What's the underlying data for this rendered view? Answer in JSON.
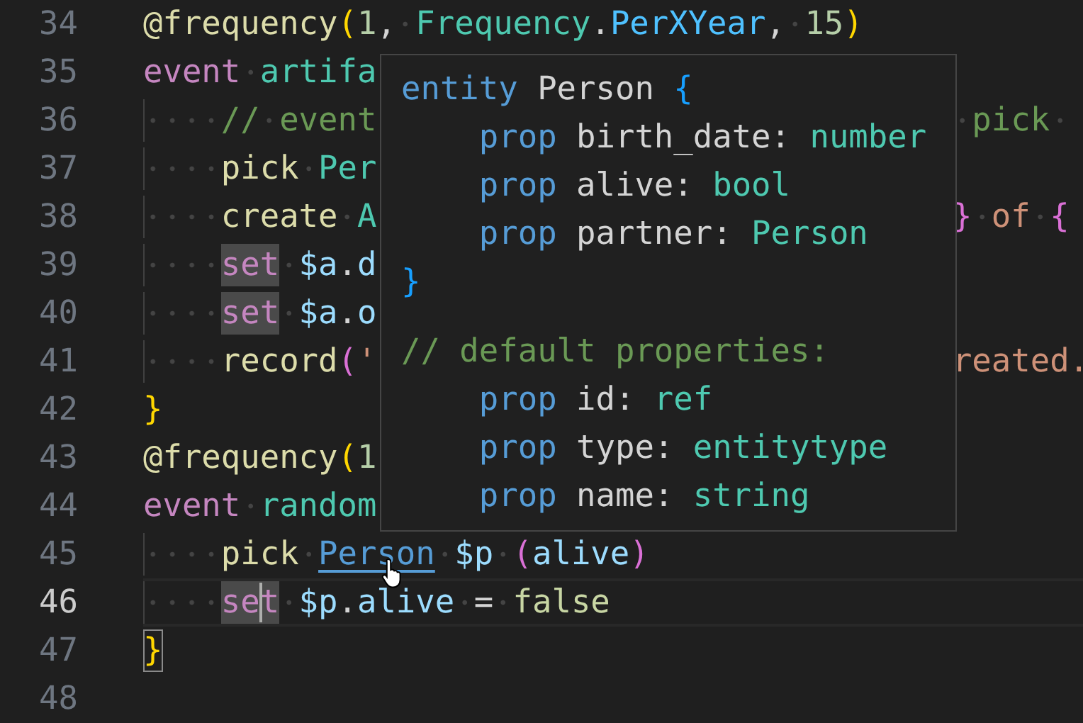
{
  "editor": {
    "lines": [
      {
        "number": "34",
        "current": false,
        "left": [
          {
            "kind": "fn",
            "t": "@frequency"
          },
          {
            "kind": "b1",
            "t": "("
          },
          {
            "kind": "num",
            "t": "1"
          },
          {
            "kind": "plain",
            "t": ","
          },
          {
            "kind": "ws"
          },
          {
            "kind": "type",
            "t": "Frequency"
          },
          {
            "kind": "plain",
            "t": "."
          },
          {
            "kind": "const",
            "t": "PerXYear"
          },
          {
            "kind": "plain",
            "t": ","
          },
          {
            "kind": "ws"
          },
          {
            "kind": "num",
            "t": "15"
          },
          {
            "kind": "b1",
            "t": ")"
          }
        ]
      },
      {
        "number": "35",
        "current": false,
        "left": [
          {
            "kind": "kw",
            "t": "event"
          },
          {
            "kind": "ws"
          },
          {
            "kind": "type",
            "t": "artifa"
          }
        ]
      },
      {
        "number": "36",
        "current": false,
        "left": [
          {
            "kind": "ws-indent"
          },
          {
            "kind": "comment",
            "t": "//"
          },
          {
            "kind": "ws"
          },
          {
            "kind": "comment",
            "t": "event"
          }
        ],
        "right": [
          {
            "kind": "ws"
          },
          {
            "kind": "comment",
            "t": "pick"
          },
          {
            "kind": "ws"
          }
        ]
      },
      {
        "number": "37",
        "current": false,
        "left": [
          {
            "kind": "ws-indent"
          },
          {
            "kind": "fn",
            "t": "pick"
          },
          {
            "kind": "ws"
          },
          {
            "kind": "type",
            "t": "Per"
          }
        ]
      },
      {
        "number": "38",
        "current": false,
        "left": [
          {
            "kind": "ws-indent"
          },
          {
            "kind": "fn",
            "t": "create"
          },
          {
            "kind": "ws"
          },
          {
            "kind": "type",
            "t": "A"
          }
        ],
        "right": [
          {
            "kind": "b2",
            "t": "}"
          },
          {
            "kind": "ws"
          },
          {
            "kind": "str",
            "t": "of"
          },
          {
            "kind": "ws"
          },
          {
            "kind": "b2",
            "t": "{"
          }
        ]
      },
      {
        "number": "39",
        "current": false,
        "left": [
          {
            "kind": "ws-indent"
          },
          {
            "kind": "kw-hl",
            "t": "set"
          },
          {
            "kind": "ws"
          },
          {
            "kind": "var",
            "t": "$a"
          },
          {
            "kind": "plain",
            "t": "."
          },
          {
            "kind": "var",
            "t": "d"
          }
        ]
      },
      {
        "number": "40",
        "current": false,
        "left": [
          {
            "kind": "ws-indent"
          },
          {
            "kind": "kw-hl",
            "t": "set"
          },
          {
            "kind": "ws"
          },
          {
            "kind": "var",
            "t": "$a"
          },
          {
            "kind": "plain",
            "t": "."
          },
          {
            "kind": "var",
            "t": "o"
          }
        ]
      },
      {
        "number": "41",
        "current": false,
        "left": [
          {
            "kind": "ws-indent"
          },
          {
            "kind": "fn",
            "t": "record"
          },
          {
            "kind": "b2",
            "t": "("
          },
          {
            "kind": "str",
            "t": "'"
          }
        ],
        "right": [
          {
            "kind": "str",
            "t": "reated."
          }
        ]
      },
      {
        "number": "42",
        "current": false,
        "left": [
          {
            "kind": "b1",
            "t": "}"
          }
        ]
      },
      {
        "number": "43",
        "current": false,
        "left": [
          {
            "kind": "fn",
            "t": "@frequency"
          },
          {
            "kind": "b1",
            "t": "("
          },
          {
            "kind": "num",
            "t": "1"
          }
        ]
      },
      {
        "number": "44",
        "current": false,
        "left": [
          {
            "kind": "kw",
            "t": "event"
          },
          {
            "kind": "ws"
          },
          {
            "kind": "type",
            "t": "random"
          }
        ]
      },
      {
        "number": "45",
        "current": false,
        "left": [
          {
            "kind": "ws-indent"
          },
          {
            "kind": "fn",
            "t": "pick"
          },
          {
            "kind": "ws"
          },
          {
            "kind": "link",
            "t": "Person"
          },
          {
            "kind": "pointer"
          },
          {
            "kind": "ws"
          },
          {
            "kind": "var",
            "t": "$p"
          },
          {
            "kind": "ws"
          },
          {
            "kind": "b2",
            "t": "("
          },
          {
            "kind": "var",
            "t": "alive"
          },
          {
            "kind": "b2",
            "t": ")"
          }
        ]
      },
      {
        "number": "46",
        "current": true,
        "left": [
          {
            "kind": "ws-indent"
          },
          {
            "kind": "kw-hl",
            "t": "se"
          },
          {
            "kind": "caret"
          },
          {
            "kind": "kw-hl",
            "t": "t"
          },
          {
            "kind": "ws"
          },
          {
            "kind": "var",
            "t": "$p"
          },
          {
            "kind": "plain",
            "t": "."
          },
          {
            "kind": "var",
            "t": "alive"
          },
          {
            "kind": "ws"
          },
          {
            "kind": "plain",
            "t": "="
          },
          {
            "kind": "ws"
          },
          {
            "kind": "lit",
            "t": "false"
          }
        ]
      },
      {
        "number": "47",
        "current": false,
        "left": [
          {
            "kind": "brace-match",
            "t": "}"
          }
        ]
      },
      {
        "number": "48",
        "current": false
      }
    ],
    "hover": {
      "sections": [
        {
          "lines": [
            [
              {
                "kind": "decl",
                "t": "entity"
              },
              {
                "kind": "sp"
              },
              {
                "kind": "plain",
                "t": "Person"
              },
              {
                "kind": "sp"
              },
              {
                "kind": "b3",
                "t": "{"
              }
            ],
            [
              {
                "kind": "sp-indent"
              },
              {
                "kind": "decl",
                "t": "prop"
              },
              {
                "kind": "sp"
              },
              {
                "kind": "plain",
                "t": "birth_date:"
              },
              {
                "kind": "sp"
              },
              {
                "kind": "type",
                "t": "number"
              }
            ],
            [
              {
                "kind": "sp-indent"
              },
              {
                "kind": "decl",
                "t": "prop"
              },
              {
                "kind": "sp"
              },
              {
                "kind": "plain",
                "t": "alive:"
              },
              {
                "kind": "sp"
              },
              {
                "kind": "type",
                "t": "bool"
              }
            ],
            [
              {
                "kind": "sp-indent"
              },
              {
                "kind": "decl",
                "t": "prop"
              },
              {
                "kind": "sp"
              },
              {
                "kind": "plain",
                "t": "partner:"
              },
              {
                "kind": "sp"
              },
              {
                "kind": "type",
                "t": "Person"
              }
            ],
            [
              {
                "kind": "b3",
                "t": "}"
              }
            ]
          ]
        },
        {
          "lines": [
            [
              {
                "kind": "comment",
                "t": "// default properties:"
              }
            ],
            [
              {
                "kind": "sp-indent"
              },
              {
                "kind": "decl",
                "t": "prop"
              },
              {
                "kind": "sp"
              },
              {
                "kind": "plain",
                "t": "id:"
              },
              {
                "kind": "sp"
              },
              {
                "kind": "type",
                "t": "ref"
              }
            ],
            [
              {
                "kind": "sp-indent"
              },
              {
                "kind": "decl",
                "t": "prop"
              },
              {
                "kind": "sp"
              },
              {
                "kind": "plain",
                "t": "type:"
              },
              {
                "kind": "sp"
              },
              {
                "kind": "type",
                "t": "entitytype"
              }
            ],
            [
              {
                "kind": "sp-indent"
              },
              {
                "kind": "decl",
                "t": "prop"
              },
              {
                "kind": "sp"
              },
              {
                "kind": "plain",
                "t": "name:"
              },
              {
                "kind": "sp"
              },
              {
                "kind": "type",
                "t": "string"
              }
            ]
          ]
        }
      ]
    }
  }
}
